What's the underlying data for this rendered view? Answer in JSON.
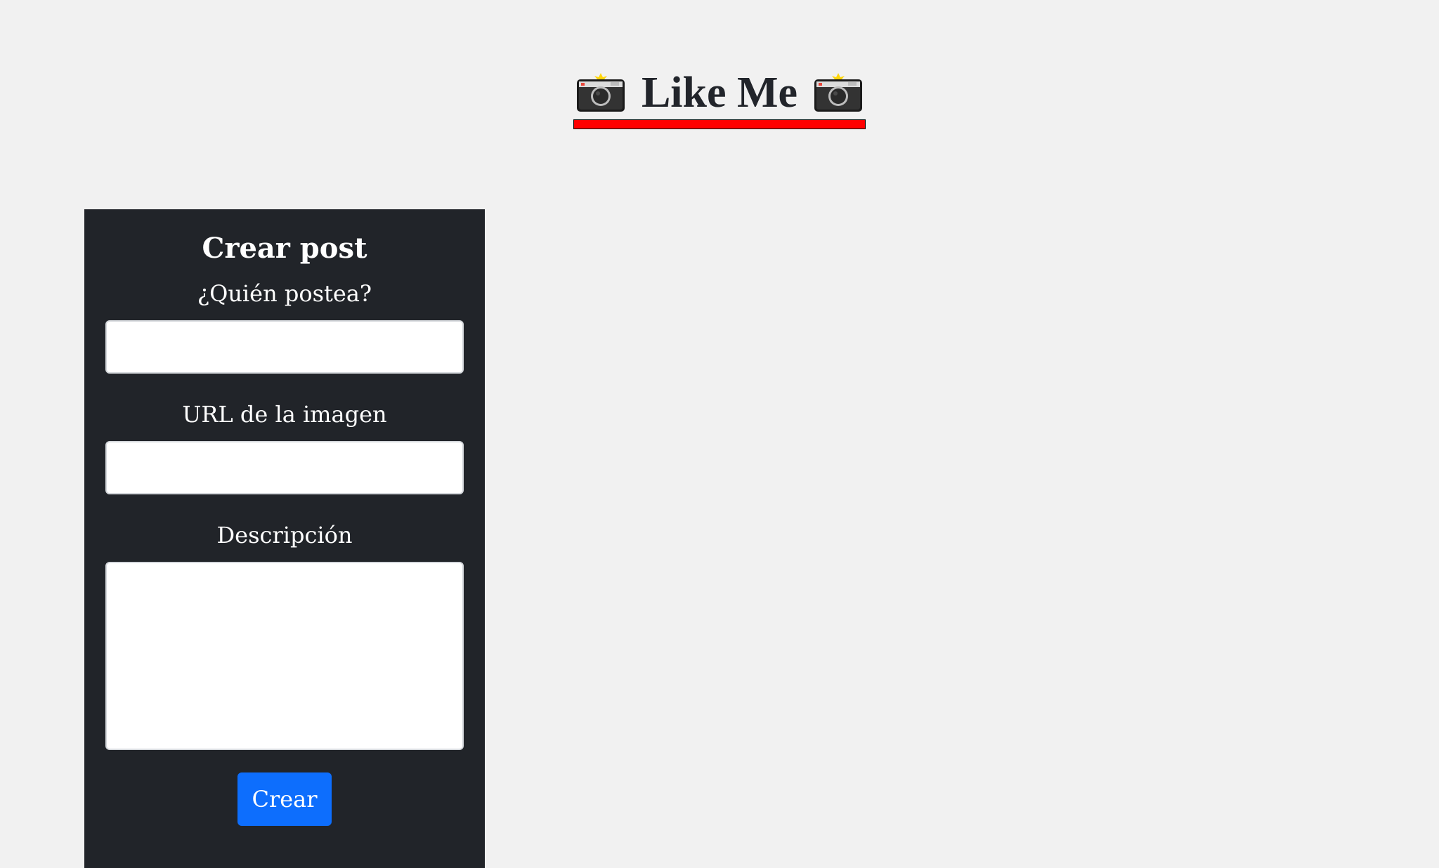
{
  "header": {
    "title": "Like Me",
    "left_icon": "camera-with-flash-icon",
    "right_icon": "camera-with-flash-icon",
    "underline_color": "#ff0000"
  },
  "form": {
    "title": "Crear post",
    "author_label": "¿Quién postea?",
    "author_value": "",
    "url_label": "URL de la imagen",
    "url_value": "",
    "description_label": "Descripción",
    "description_value": "",
    "submit_label": "Crear",
    "panel_color": "#212429",
    "button_color": "#0d6efd"
  }
}
